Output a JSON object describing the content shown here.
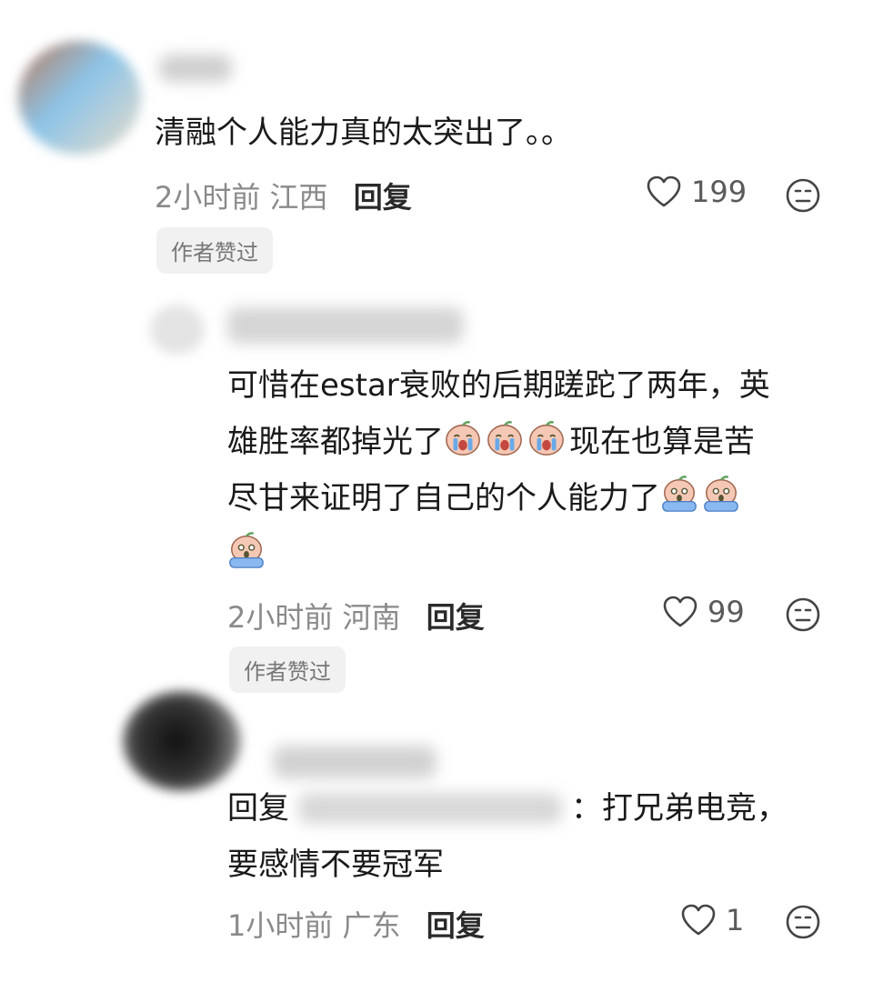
{
  "colors": {
    "text": "#1a1a1a",
    "meta": "#8a8a8a",
    "badge_bg": "#f1f1f1"
  },
  "comments": [
    {
      "text": "清融个人能力真的太突出了。。",
      "time": "2小时前",
      "location": "江西",
      "reply_label": "回复",
      "likes": "199",
      "badge": "作者赞过"
    },
    {
      "text_line1": "可惜在estar衰败的后期蹉跎了两年，英",
      "text_line2_a": "雄胜率都掉光了",
      "text_line2_b": "现在也算是苦",
      "text_line3": "尽甘来证明了自己的个人能力了",
      "time": "2小时前",
      "location": "河南",
      "reply_label": "回复",
      "likes": "99",
      "badge": "作者赞过",
      "emojis": [
        "crying-face",
        "crying-face",
        "crying-face",
        "scared-face",
        "scared-face",
        "scared-face"
      ]
    },
    {
      "reply_prefix": "回复",
      "reply_text": "：打兄弟电竞，",
      "text_line2": "要感情不要冠军",
      "time": "1小时前",
      "location": "广东",
      "reply_label": "回复",
      "likes": "1"
    }
  ],
  "icons": [
    "heart-icon",
    "meh-face-icon"
  ]
}
